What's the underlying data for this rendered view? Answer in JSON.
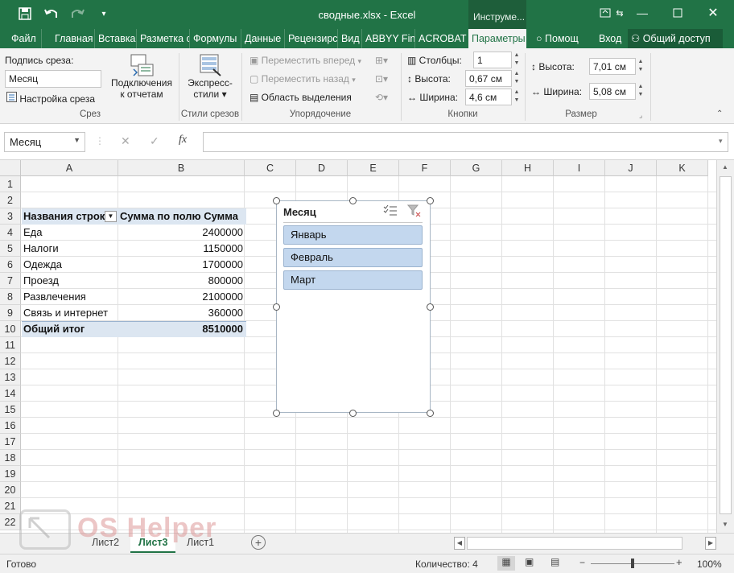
{
  "window": {
    "title": "сводные.xlsx - Excel",
    "context_title": "Инструме..."
  },
  "ribbon_tabs": [
    "Файл",
    "Главная",
    "Вставка",
    "Разметка с",
    "Формулы",
    "Данные",
    "Рецензирс",
    "Вид",
    "ABBYY Fin",
    "ACROBAT",
    "Параметры"
  ],
  "tell_me": "Помощ",
  "sign_in": "Вход",
  "share": "Общий доступ",
  "ribbon": {
    "slicer_caption_label": "Подпись среза:",
    "slicer_caption_value": "Месяц",
    "slicer_settings": "Настройка среза",
    "group_slicer": "Срез",
    "report_connections_l1": "Подключения",
    "report_connections_l2": "к отчетам",
    "quick_styles_l1": "Экспресс-",
    "quick_styles_l2": "стили",
    "group_styles": "Стили срезов",
    "bring_forward": "Переместить вперед",
    "send_backward": "Переместить назад",
    "selection_pane": "Область выделения",
    "group_arrange": "Упорядочение",
    "columns_label": "Столбцы:",
    "columns_value": "1",
    "btn_height_label": "Высота:",
    "btn_height_value": "0,67 см",
    "btn_width_label": "Ширина:",
    "btn_width_value": "4,6 см",
    "group_buttons": "Кнопки",
    "size_height_label": "Высота:",
    "size_height_value": "7,01 см",
    "size_width_label": "Ширина:",
    "size_width_value": "5,08 см",
    "group_size": "Размер"
  },
  "formula_bar": {
    "name_box": "Месяц",
    "fx": "fx",
    "formula": ""
  },
  "columns": [
    "A",
    "B",
    "C",
    "D",
    "E",
    "F",
    "G",
    "H",
    "I",
    "J",
    "K"
  ],
  "rows": [
    "1",
    "2",
    "3",
    "4",
    "5",
    "6",
    "7",
    "8",
    "9",
    "10",
    "11",
    "12",
    "13",
    "14",
    "15",
    "16",
    "17",
    "18",
    "19",
    "20",
    "21",
    "22"
  ],
  "pivot": {
    "header_row_labels": "Названия строк",
    "header_sum": "Сумма по полю Сумма",
    "rows": [
      {
        "label": "Еда",
        "value": "2400000"
      },
      {
        "label": "Налоги",
        "value": "1150000"
      },
      {
        "label": "Одежда",
        "value": "1700000"
      },
      {
        "label": "Проезд",
        "value": "800000"
      },
      {
        "label": "Развлечения",
        "value": "2100000"
      },
      {
        "label": "Связь и интернет",
        "value": "360000"
      }
    ],
    "total_label": "Общий итог",
    "total_value": "8510000"
  },
  "slicer": {
    "title": "Месяц",
    "items": [
      "Январь",
      "Февраль",
      "Март"
    ]
  },
  "sheets": [
    "Лист2",
    "Лист3",
    "Лист1"
  ],
  "active_sheet": "Лист3",
  "status": {
    "ready": "Готово",
    "count": "Количество: 4",
    "zoom": "100%"
  },
  "watermark_text": "OS Helper",
  "colors": {
    "accent": "#217346",
    "pivot_header": "#dce6f1",
    "slicer_item": "#c3d7ee"
  }
}
